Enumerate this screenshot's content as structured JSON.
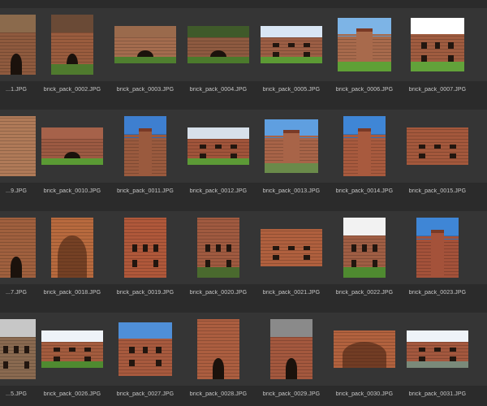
{
  "browser": {
    "columns_x": [
      -25,
      44,
      134,
      224,
      314,
      404,
      494,
      584
    ],
    "rows_y": [
      10,
      135,
      260,
      385
    ],
    "items": [
      [
        {
          "label": "...1.JPG",
          "photo": {
            "kind": "wall-arch",
            "sky": "#8b6a4c",
            "wall": "#8f5a3e",
            "grass": "",
            "orient": "portrait"
          }
        },
        {
          "label": "brick_pack_0002.JPG",
          "photo": {
            "kind": "wall-arch",
            "sky": "#6a4a36",
            "wall": "#9a5c3e",
            "grass": "#4f7a2e",
            "orient": "portrait"
          }
        },
        {
          "label": "brick_pack_0003.JPG",
          "photo": {
            "kind": "gate",
            "sky": "#9a6a4c",
            "wall": "#a46c4e",
            "grass": "#4f7f2f",
            "orient": "landscape"
          }
        },
        {
          "label": "brick_pack_0004.JPG",
          "photo": {
            "kind": "gate",
            "sky": "#3f5a2a",
            "wall": "#8e5a40",
            "grass": "#4b7a2c",
            "orient": "landscape"
          }
        },
        {
          "label": "brick_pack_0005.JPG",
          "photo": {
            "kind": "castle",
            "sky": "#d9e6f4",
            "wall": "#9c5e44",
            "grass": "#5c9a34",
            "orient": "landscape"
          }
        },
        {
          "label": "brick_pack_0006.JPG",
          "photo": {
            "kind": "tower",
            "sky": "#7db4e6",
            "wall": "#a86a4c",
            "grass": "#5fa036",
            "orient": "square"
          }
        },
        {
          "label": "brick_pack_0007.JPG",
          "photo": {
            "kind": "castle",
            "sky": "#ffffff",
            "wall": "#a05c40",
            "grass": "#62a23a",
            "orient": "square"
          }
        },
        {
          "label": "...",
          "photo": {
            "kind": "tower",
            "sky": "#7fb0de",
            "wall": "#9a5a3e",
            "grass": "",
            "orient": "portrait"
          }
        }
      ],
      [
        {
          "label": "...9.JPG",
          "photo": {
            "kind": "bricks",
            "sky": "",
            "wall": "#b07a58",
            "grass": "",
            "orient": "portrait"
          }
        },
        {
          "label": "brick_pack_0010.JPG",
          "photo": {
            "kind": "gate",
            "sky": "#a6624a",
            "wall": "#9c5a42",
            "grass": "#5a9a34",
            "orient": "landscape"
          }
        },
        {
          "label": "brick_pack_0011.JPG",
          "photo": {
            "kind": "church",
            "sky": "#3e7fd0",
            "wall": "#9a5a3e",
            "grass": "",
            "orient": "portrait"
          }
        },
        {
          "label": "brick_pack_0012.JPG",
          "photo": {
            "kind": "castle",
            "sky": "#d7e0ea",
            "wall": "#a0543a",
            "grass": "#5c9a36",
            "orient": "landscape"
          }
        },
        {
          "label": "brick_pack_0013.JPG",
          "photo": {
            "kind": "tower",
            "sky": "#5f9fe0",
            "wall": "#a86448",
            "grass": "#6a8a4a",
            "orient": "square"
          }
        },
        {
          "label": "brick_pack_0014.JPG",
          "photo": {
            "kind": "tower",
            "sky": "#3f86d6",
            "wall": "#a85a3e",
            "grass": "",
            "orient": "portrait"
          }
        },
        {
          "label": "brick_pack_0015.JPG",
          "photo": {
            "kind": "building",
            "sky": "",
            "wall": "#a4583c",
            "grass": "",
            "orient": "landscape"
          }
        },
        {
          "label": "...",
          "photo": {
            "kind": "tower",
            "sky": "#4f8fd8",
            "wall": "#9a5a3e",
            "grass": "",
            "orient": "portrait"
          }
        }
      ],
      [
        {
          "label": "...7.JPG",
          "photo": {
            "kind": "wall-arch",
            "sky": "",
            "wall": "#a0603e",
            "grass": "",
            "orient": "portrait"
          }
        },
        {
          "label": "brick_pack_0018.JPG",
          "photo": {
            "kind": "vault",
            "sky": "",
            "wall": "#b86a3e",
            "grass": "",
            "orient": "portrait"
          }
        },
        {
          "label": "brick_pack_0019.JPG",
          "photo": {
            "kind": "building",
            "sky": "",
            "wall": "#b0583a",
            "grass": "",
            "orient": "portrait"
          }
        },
        {
          "label": "brick_pack_0020.JPG",
          "photo": {
            "kind": "stairs",
            "sky": "",
            "wall": "#a05a40",
            "grass": "#4a6a2e",
            "orient": "portrait"
          }
        },
        {
          "label": "brick_pack_0021.JPG",
          "photo": {
            "kind": "building",
            "sky": "",
            "wall": "#b0603e",
            "grass": "",
            "orient": "landscape"
          }
        },
        {
          "label": "brick_pack_0022.JPG",
          "photo": {
            "kind": "castle",
            "sky": "#f2f2f2",
            "wall": "#a05e44",
            "grass": "#4f8a30",
            "orient": "portrait"
          }
        },
        {
          "label": "brick_pack_0023.JPG",
          "photo": {
            "kind": "church",
            "sky": "#3f86d6",
            "wall": "#a4523a",
            "grass": "",
            "orient": "portrait"
          }
        },
        {
          "label": "...",
          "photo": {
            "kind": "building",
            "sky": "",
            "wall": "#a0583c",
            "grass": "",
            "orient": "portrait"
          }
        }
      ],
      [
        {
          "label": "...5.JPG",
          "photo": {
            "kind": "castle",
            "sky": "#c7c7c7",
            "wall": "#8a6a50",
            "grass": "",
            "orient": "portrait"
          }
        },
        {
          "label": "brick_pack_0026.JPG",
          "photo": {
            "kind": "castle",
            "sky": "#eef3f8",
            "wall": "#a45c3e",
            "grass": "#4f8a30",
            "orient": "landscape"
          }
        },
        {
          "label": "brick_pack_0027.JPG",
          "photo": {
            "kind": "building",
            "sky": "#4f8fd8",
            "wall": "#a85a3e",
            "grass": "",
            "orient": "square"
          }
        },
        {
          "label": "brick_pack_0028.JPG",
          "photo": {
            "kind": "door",
            "sky": "",
            "wall": "#ac5e40",
            "grass": "",
            "orient": "portrait"
          }
        },
        {
          "label": "brick_pack_0029.JPG",
          "photo": {
            "kind": "wall-arch",
            "sky": "#8a8a8a",
            "wall": "#a4583e",
            "grass": "",
            "orient": "portrait"
          }
        },
        {
          "label": "brick_pack_0030.JPG",
          "photo": {
            "kind": "vault",
            "sky": "",
            "wall": "#b2623e",
            "grass": "",
            "orient": "landscape"
          }
        },
        {
          "label": "brick_pack_0031.JPG",
          "photo": {
            "kind": "castle",
            "sky": "#eef3f8",
            "wall": "#a4583e",
            "grass": "#7a8a7a",
            "orient": "landscape"
          }
        },
        {
          "label": "...",
          "photo": {
            "kind": "tower",
            "sky": "#eef3f8",
            "wall": "#9a5a3e",
            "grass": "",
            "orient": "portrait"
          }
        }
      ]
    ]
  }
}
